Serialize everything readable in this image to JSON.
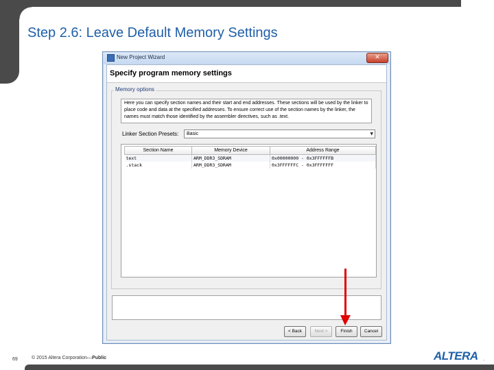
{
  "slide": {
    "title": "Step 2.6: Leave Default Memory Settings",
    "page_number": "69",
    "copyright_prefix": "© 2015 Altera Corporation—",
    "copyright_bold": "Public",
    "logo_text": "ALTERA",
    "logo_suffix": ".",
    "accent_color": "#1f5fa8",
    "annotation_arrow_color": "#e00000"
  },
  "window": {
    "title": "New Project Wizard",
    "close_glyph": "✕",
    "page_heading": "Specify program memory settings",
    "memory_options_label": "Memory options",
    "info_text": "Here you can specify section names and their start and end addresses. These sections will be used by the linker to place code and data at the specified addresses. To ensure correct use of the section names by the linker, the names must match those identified by the assembler directives, such as .text.",
    "preset_label": "Linker Section Presets:",
    "preset_value": "Basic",
    "preset_arrow": "▼",
    "table": {
      "headers": [
        "Section Name",
        "Memory Device",
        "Address Range"
      ],
      "rows": [
        [
          "text",
          "ARM_DDR3_SDRAM",
          "0x00000000 - 0x3FFFFFFB"
        ],
        [
          ".stack",
          "ARM_DDR3_SDRAM",
          "0x3FFFFFFC - 0x3FFFFFFF"
        ]
      ]
    },
    "buttons": {
      "back": "< Back",
      "next": "Next >",
      "finish": "Finish",
      "cancel": "Cancel"
    }
  }
}
